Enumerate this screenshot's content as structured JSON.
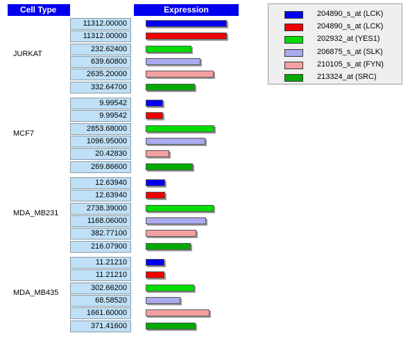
{
  "chart_data": {
    "type": "bar",
    "orientation": "horizontal",
    "headers": {
      "cell_type": "Cell Type",
      "expression": "Expression"
    },
    "series": [
      {
        "name": "204890_s_at (LCK)",
        "color": "#0000ee"
      },
      {
        "name": "204890_s_at (LCK)",
        "color": "#ee0000"
      },
      {
        "name": "202932_at (YES1)",
        "color": "#00dd00"
      },
      {
        "name": "206875_s_at (SLK)",
        "color": "#aaaaee"
      },
      {
        "name": "210105_s_at (FYN)",
        "color": "#f5a0a0"
      },
      {
        "name": "213324_at (SRC)",
        "color": "#00aa00"
      }
    ],
    "groups": [
      {
        "name": "JURKAT",
        "labels": [
          "11312.00000",
          "11312.00000",
          "232.62400",
          "639.60800",
          "2635.20000",
          "332.64700"
        ],
        "values": [
          11312.0,
          11312.0,
          232.624,
          639.608,
          2635.2,
          332.647
        ]
      },
      {
        "name": "MCF7",
        "labels": [
          "9.99542",
          "9.99542",
          "2853.68000",
          "1096.95000",
          "20.42830",
          "269.86600"
        ],
        "values": [
          9.99542,
          9.99542,
          2853.68,
          1096.95,
          20.4283,
          269.866
        ]
      },
      {
        "name": "MDA_MB231",
        "labels": [
          "12.63940",
          "12.63940",
          "2738.39000",
          "1168.06000",
          "382.77100",
          "216.07900"
        ],
        "values": [
          12.6394,
          12.6394,
          2738.39,
          1168.06,
          382.771,
          216.079
        ]
      },
      {
        "name": "MDA_MB435",
        "labels": [
          "11.21210",
          "11.21210",
          "302.66200",
          "68.58520",
          "1661.60000",
          "371.41600"
        ],
        "values": [
          11.2121,
          11.2121,
          302.662,
          68.5852,
          1661.6,
          371.416
        ]
      }
    ],
    "scale": "log"
  }
}
